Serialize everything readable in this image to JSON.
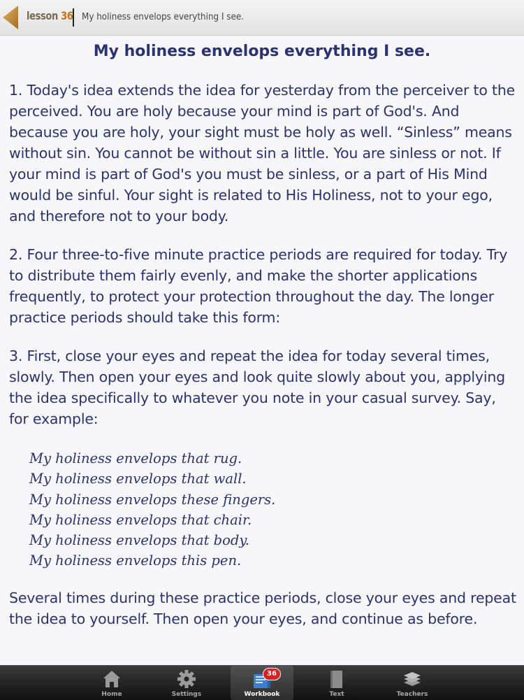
{
  "header": {
    "lesson_prefix": "lesson",
    "lesson_number": "36",
    "subtitle": "My holiness envelops everything I see."
  },
  "page": {
    "title": "My holiness envelops everything I see.",
    "paragraphs": [
      "1. Today's idea extends the idea for yesterday from the perceiver to the perceived. You are holy because your mind is part of God's. And because you are holy, your sight must be holy as well. “Sinless” means without sin. You cannot be without sin a little. You are sinless or not. If your mind is part of God's you must be sinless, or a part of His Mind would be sinful. Your sight is related to His Holiness, not to your ego, and therefore not to your body.",
      "2. Four three-to-five minute practice periods are required for today. Try to distribute them fairly evenly, and make the shorter applications frequently, to protect your protection throughout the day. The longer practice periods should take this form:",
      "3. First, close your eyes and repeat the idea for today several times, slowly. Then open your eyes and look quite slowly about you, applying the idea specifically to whatever you note in your casual survey. Say, for example:",
      "Several times during these practice periods, close your eyes and repeat the idea to yourself. Then open your eyes, and continue as before."
    ],
    "examples": [
      "My holiness envelops that rug.",
      "My holiness envelops that wall.",
      "My holiness envelops these fingers.",
      "My holiness envelops that chair.",
      "My holiness envelops that body.",
      "My holiness envelops this pen."
    ]
  },
  "tabbar": {
    "items": [
      {
        "label": "Home",
        "icon": "home-icon"
      },
      {
        "label": "Settings",
        "icon": "gear-icon"
      },
      {
        "label": "Workbook",
        "icon": "workbook-icon",
        "badge": "36",
        "active": true
      },
      {
        "label": "Text",
        "icon": "book-icon"
      },
      {
        "label": "Teachers",
        "icon": "books-stack-icon"
      }
    ]
  },
  "colors": {
    "text": "#2b3270",
    "accent": "#c5761c",
    "badge": "#d62222"
  }
}
